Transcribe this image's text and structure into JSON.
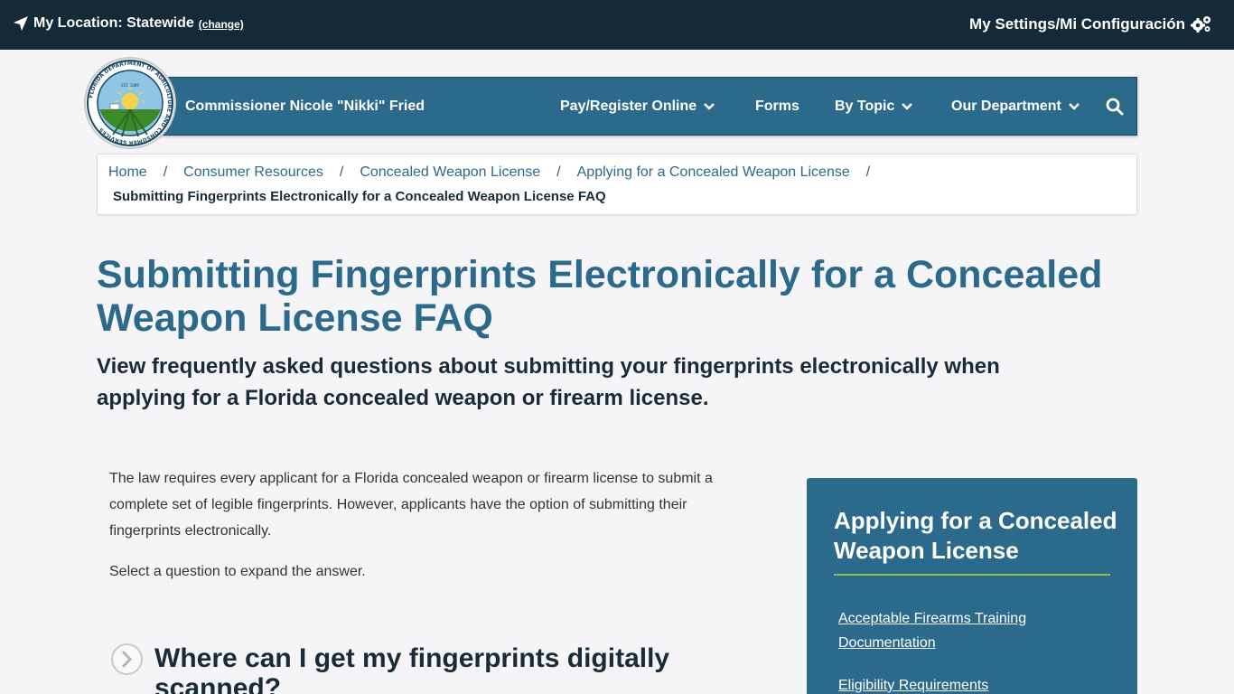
{
  "topbar": {
    "location_label": "My Location: Statewide",
    "change_label": "(change)",
    "settings_label": "My Settings/Mi Configuración"
  },
  "nav": {
    "brand": "Commissioner Nicole \"Nikki\" Fried",
    "items": [
      "Pay/Register Online",
      "Forms",
      "By Topic",
      "Our Department"
    ],
    "search_icon": "search-icon"
  },
  "logo": {
    "ring_text": "FLORIDA DEPARTMENT OF AGRICULTURE AND CONSUMER SERVICES",
    "est": "EST. 1889"
  },
  "breadcrumb": {
    "links": [
      "Home",
      "Consumer Resources",
      "Concealed Weapon License",
      "Applying for a Concealed Weapon License"
    ],
    "separator": "/",
    "current": "Submitting Fingerprints Electronically for a Concealed Weapon License FAQ"
  },
  "page": {
    "title": "Submitting Fingerprints Electronically for a Concealed Weapon License FAQ",
    "subtitle": "View frequently asked questions about submitting your fingerprints electronically when applying for a Florida concealed weapon or firearm license.",
    "intro": "The law requires every applicant for a Florida concealed weapon or firearm license to submit a complete set of legible fingerprints. However, applicants have the option of submitting their fingerprints electronically.",
    "prompt": "Select a question to expand the answer."
  },
  "faq": {
    "question_1": "Where can I get my fingerprints digitally scanned?"
  },
  "sidebar": {
    "title": "Applying for a Concealed Weapon License",
    "links": [
      "Acceptable Firearms Training Documentation",
      "Eligibility Requirements"
    ]
  },
  "colors": {
    "topbar": "#142a38",
    "brand_blue": "#2c6a8c",
    "accent_green": "#8bc34a",
    "page_bg": "#f5f5f7"
  }
}
